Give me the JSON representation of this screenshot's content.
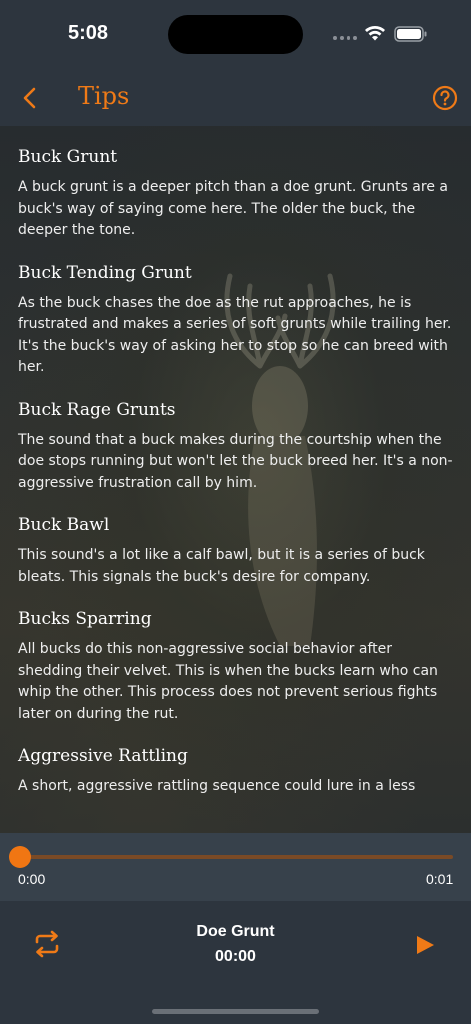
{
  "status_bar": {
    "time": "5:08"
  },
  "nav": {
    "title": "Tips",
    "back_icon": "chevron-left",
    "help_icon": "question-circle"
  },
  "colors": {
    "accent": "#ef7a17",
    "header": "#2d353e",
    "progress_bg": "#37414b"
  },
  "tips": [
    {
      "title": "Buck Grunt",
      "body": "A buck grunt is a deeper pitch than a doe grunt. Grunts are a buck's way of saying come here. The older the buck, the deeper the tone."
    },
    {
      "title": "Buck Tending Grunt",
      "body": "As the buck chases the doe as the rut approaches, he is frustrated and makes a series of soft grunts while trailing her. It's the buck's way of asking her to stop so he can breed with her."
    },
    {
      "title": "Buck Rage Grunts",
      "body": "The sound that a buck makes during the courtship when the doe stops running but won't let the buck breed her. It's a non-aggressive frustration call by him."
    },
    {
      "title": "Buck Bawl",
      "body": "This sound's a lot like a calf bawl, but it is a series of buck bleats. This signals the buck's desire for company."
    },
    {
      "title": "Bucks Sparring",
      "body": "All bucks do this non-aggressive social behavior after shedding their velvet. This is when the bucks learn who can whip the other. This process does not prevent serious fights later on during the rut."
    },
    {
      "title": "Aggressive Rattling",
      "body": "A short, aggressive rattling sequence could lure in a less"
    }
  ],
  "progress": {
    "current": "0:00",
    "total": "0:01",
    "fraction": 0.0
  },
  "player": {
    "track_name": "Doe Grunt",
    "elapsed": "00:00",
    "repeat_icon": "repeat",
    "play_icon": "play"
  }
}
